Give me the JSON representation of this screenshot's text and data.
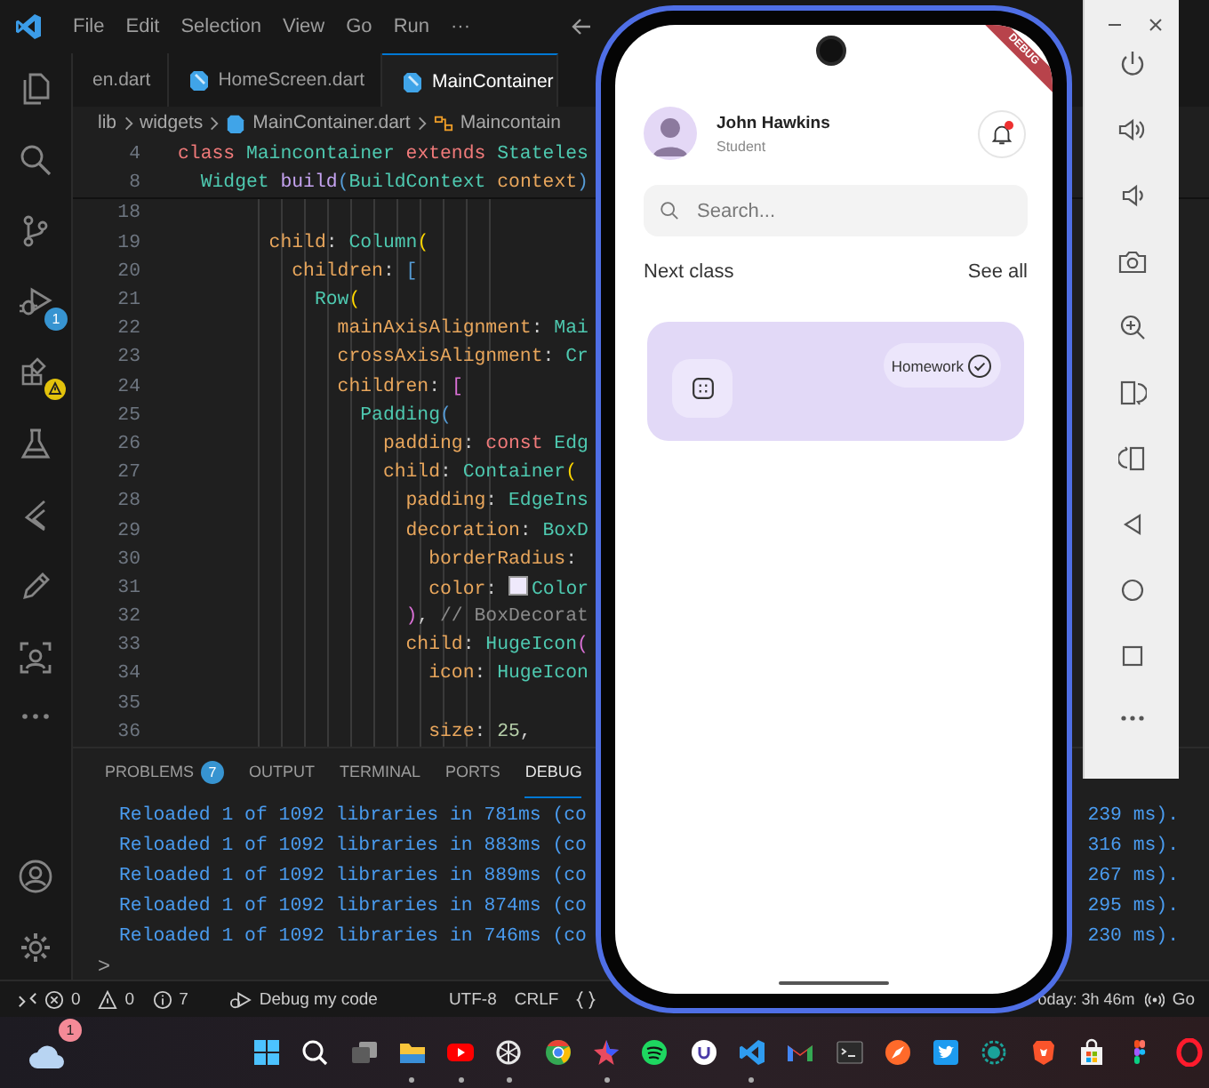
{
  "titlebar": {
    "menus": [
      "File",
      "Edit",
      "Selection",
      "View",
      "Go",
      "Run",
      "···"
    ]
  },
  "activity_bar": {
    "debug_badge": "1"
  },
  "tabs": [
    {
      "label": "en.dart",
      "selected": false
    },
    {
      "label": "HomeScreen.dart",
      "selected": false
    },
    {
      "label": "MainContainer",
      "selected": true
    }
  ],
  "breadcrumb": [
    {
      "label": "lib",
      "kind": "folder"
    },
    {
      "label": "widgets",
      "kind": "folder"
    },
    {
      "label": "MainContainer.dart",
      "kind": "file"
    },
    {
      "label": "Maincontain",
      "kind": "symbol"
    }
  ],
  "sticky_lines": [
    {
      "number": "4",
      "tokens": [
        {
          "text": "class ",
          "color": "#f07a7a"
        },
        {
          "text": "Maincontainer ",
          "color": "#4ec9b0"
        },
        {
          "text": "extends ",
          "color": "#f07a7a"
        },
        {
          "text": "Stateles",
          "color": "#4ec9b0"
        }
      ]
    },
    {
      "number": "8",
      "tokens": [
        {
          "text": "  Widget ",
          "color": "#4ec9b0"
        },
        {
          "text": "build",
          "color": "#c5a3f0"
        },
        {
          "text": "(",
          "color": "#569cd6"
        },
        {
          "text": "BuildContext ",
          "color": "#4ec9b0"
        },
        {
          "text": "context",
          "color": "#e8a65c"
        },
        {
          "text": ")",
          "color": "#569cd6"
        }
      ]
    }
  ],
  "code_lines": [
    {
      "number": "18"
    },
    {
      "number": "19",
      "tokens": [
        {
          "text": "        child",
          "color": "#e8a65c"
        },
        {
          "text": ": ",
          "color": "#cccccc"
        },
        {
          "text": "Column",
          "color": "#4ec9b0"
        },
        {
          "text": "(",
          "color": "#ffd700"
        }
      ]
    },
    {
      "number": "20",
      "tokens": [
        {
          "text": "          children",
          "color": "#e8a65c"
        },
        {
          "text": ": ",
          "color": "#cccccc"
        },
        {
          "text": "[",
          "color": "#569cd6"
        }
      ]
    },
    {
      "number": "21",
      "tokens": [
        {
          "text": "            Row",
          "color": "#4ec9b0"
        },
        {
          "text": "(",
          "color": "#ffd700"
        }
      ]
    },
    {
      "number": "22",
      "tokens": [
        {
          "text": "              mainAxisAlignment",
          "color": "#e8a65c"
        },
        {
          "text": ": ",
          "color": "#cccccc"
        },
        {
          "text": "Mai",
          "color": "#4ec9b0"
        }
      ]
    },
    {
      "number": "23",
      "tokens": [
        {
          "text": "              crossAxisAlignment",
          "color": "#e8a65c"
        },
        {
          "text": ": ",
          "color": "#cccccc"
        },
        {
          "text": "Cr",
          "color": "#4ec9b0"
        }
      ]
    },
    {
      "number": "24",
      "tokens": [
        {
          "text": "              children",
          "color": "#e8a65c"
        },
        {
          "text": ": ",
          "color": "#cccccc"
        },
        {
          "text": "[",
          "color": "#da70d6"
        }
      ]
    },
    {
      "number": "25",
      "tokens": [
        {
          "text": "                Padding",
          "color": "#4ec9b0"
        },
        {
          "text": "(",
          "color": "#569cd6"
        }
      ]
    },
    {
      "number": "26",
      "tokens": [
        {
          "text": "                  padding",
          "color": "#e8a65c"
        },
        {
          "text": ": ",
          "color": "#cccccc"
        },
        {
          "text": "const ",
          "color": "#f07a7a"
        },
        {
          "text": "Edg",
          "color": "#4ec9b0"
        }
      ]
    },
    {
      "number": "27",
      "tokens": [
        {
          "text": "                  child",
          "color": "#e8a65c"
        },
        {
          "text": ": ",
          "color": "#cccccc"
        },
        {
          "text": "Container",
          "color": "#4ec9b0"
        },
        {
          "text": "(",
          "color": "#ffd700"
        }
      ]
    },
    {
      "number": "28",
      "tokens": [
        {
          "text": "                    padding",
          "color": "#e8a65c"
        },
        {
          "text": ": ",
          "color": "#cccccc"
        },
        {
          "text": "EdgeIns",
          "color": "#4ec9b0"
        }
      ]
    },
    {
      "number": "29",
      "tokens": [
        {
          "text": "                    decoration",
          "color": "#e8a65c"
        },
        {
          "text": ": ",
          "color": "#cccccc"
        },
        {
          "text": "BoxD",
          "color": "#4ec9b0"
        }
      ]
    },
    {
      "number": "30",
      "tokens": [
        {
          "text": "                      borderRadius",
          "color": "#e8a65c"
        },
        {
          "text": ":",
          "color": "#cccccc"
        }
      ]
    },
    {
      "number": "31",
      "tokens": [
        {
          "text": "                      color",
          "color": "#e8a65c"
        },
        {
          "text": ": ",
          "color": "#cccccc"
        },
        {
          "kind": "swatch",
          "color": "#efe9fb"
        },
        {
          "text": "Color",
          "color": "#4ec9b0"
        }
      ]
    },
    {
      "number": "32",
      "tokens": [
        {
          "text": "                    )",
          "color": "#da70d6"
        },
        {
          "text": ", ",
          "color": "#cccccc"
        },
        {
          "text": "// BoxDecorat",
          "color": "#8b8b8b"
        }
      ]
    },
    {
      "number": "33",
      "tokens": [
        {
          "text": "                    child",
          "color": "#e8a65c"
        },
        {
          "text": ": ",
          "color": "#cccccc"
        },
        {
          "text": "HugeIcon",
          "color": "#4ec9b0"
        },
        {
          "text": "(",
          "color": "#da70d6"
        }
      ]
    },
    {
      "number": "34",
      "tokens": [
        {
          "text": "                      icon",
          "color": "#e8a65c"
        },
        {
          "text": ": ",
          "color": "#cccccc"
        },
        {
          "text": "HugeIcon",
          "color": "#4ec9b0"
        }
      ]
    },
    {
      "number": "35"
    },
    {
      "number": "36",
      "tokens": [
        {
          "text": "                      size",
          "color": "#e8a65c"
        },
        {
          "text": ": ",
          "color": "#cccccc"
        },
        {
          "text": "25",
          "color": "#b5cea8"
        },
        {
          "text": ",",
          "color": "#cccccc"
        }
      ]
    }
  ],
  "panel": {
    "tabs": [
      {
        "label": "PROBLEMS",
        "count": "7",
        "selected": false
      },
      {
        "label": "OUTPUT",
        "selected": false
      },
      {
        "label": "TERMINAL",
        "selected": false
      },
      {
        "label": "PORTS",
        "selected": false
      },
      {
        "label": "DEBUG",
        "selected": true
      }
    ],
    "output": [
      {
        "left": "Reloaded 1 of 1092 libraries in 781ms (co",
        "right": "239 ms)."
      },
      {
        "left": "Reloaded 1 of 1092 libraries in 883ms (co",
        "right": "316 ms)."
      },
      {
        "left": "Reloaded 1 of 1092 libraries in 889ms (co",
        "right": "267 ms)."
      },
      {
        "left": "Reloaded 1 of 1092 libraries in 874ms (co",
        "right": "295 ms)."
      },
      {
        "left": "Reloaded 1 of 1092 libraries in 746ms (co",
        "right": "230 ms)."
      }
    ],
    "prompt": ">"
  },
  "status_bar": {
    "errors": "0",
    "warnings": "0",
    "infos": "7",
    "debug_label": "Debug my code",
    "encoding": "UTF-8",
    "line_ending": "CRLF",
    "time": "oday: 3h 46m",
    "go_live": "Go"
  },
  "phone": {
    "debug_banner": "DEBUG",
    "user": {
      "name": "John Hawkins",
      "role": "Student"
    },
    "notification_unread": true,
    "search": {
      "placeholder": "Search..."
    },
    "section": {
      "title": "Next class",
      "link": "See all"
    },
    "card": {
      "tag": "Homework"
    }
  },
  "taskbar": {
    "weather_badge": "1",
    "apps": [
      {
        "kind": "start",
        "running": false
      },
      {
        "kind": "search",
        "running": false
      },
      {
        "kind": "taskview",
        "running": false
      },
      {
        "kind": "folder",
        "running": true
      },
      {
        "kind": "play",
        "running": true
      },
      {
        "kind": "knot",
        "running": true
      },
      {
        "kind": "circle",
        "running": false
      },
      {
        "kind": "star",
        "running": true
      },
      {
        "kind": "waves",
        "running": false
      },
      {
        "kind": "disc",
        "running": false
      },
      {
        "kind": "code",
        "running": true
      },
      {
        "kind": "mail",
        "running": false
      },
      {
        "kind": "terminal",
        "running": false
      },
      {
        "kind": "compass",
        "running": false
      },
      {
        "kind": "bird",
        "running": false
      },
      {
        "kind": "ring",
        "running": false
      },
      {
        "kind": "shield",
        "running": false
      },
      {
        "kind": "bag",
        "running": false
      },
      {
        "kind": "shapes",
        "running": false
      },
      {
        "kind": "oval",
        "running": false
      }
    ]
  }
}
